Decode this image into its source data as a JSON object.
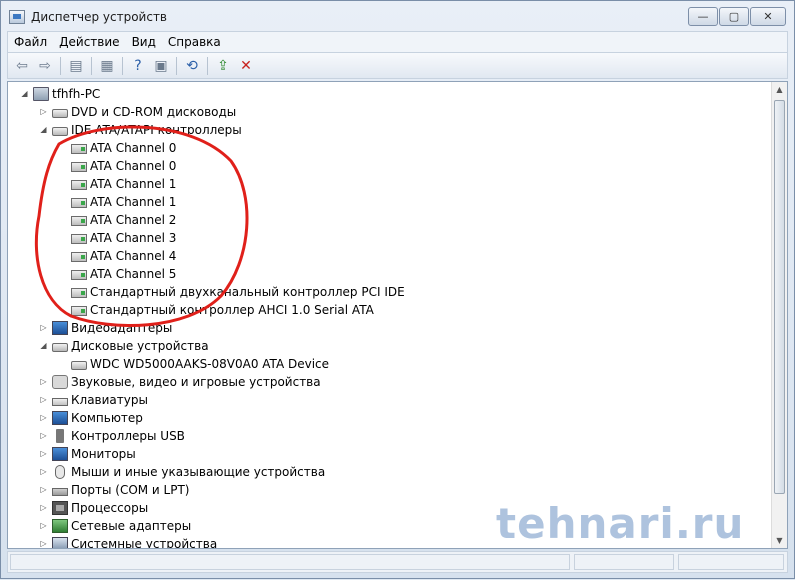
{
  "window": {
    "title": "Диспетчер устройств",
    "buttons": {
      "minimize": "—",
      "maximize": "▢",
      "close": "✕"
    }
  },
  "menu": [
    "Файл",
    "Действие",
    "Вид",
    "Справка"
  ],
  "toolbar": {
    "icons": [
      "back-arrow-icon",
      "forward-arrow-icon",
      "show-hide-console-tree-icon",
      "properties-icon",
      "help-icon",
      "view-icon",
      "scan-hardware-icon",
      "update-driver-icon",
      "uninstall-device-icon"
    ]
  },
  "tree": {
    "root": "tfhfh-PC",
    "items": [
      {
        "label": "DVD и CD-ROM дисководы",
        "icon": "dvd-drive-icon",
        "expander": "▷"
      },
      {
        "label": "IDE ATA/ATAPI контроллеры",
        "icon": "ide-controller-icon",
        "expander": "◢"
      },
      {
        "label": "ATA Channel 0",
        "icon": "ide-channel-icon"
      },
      {
        "label": "ATA Channel 0",
        "icon": "ide-channel-icon"
      },
      {
        "label": "ATA Channel 1",
        "icon": "ide-channel-icon"
      },
      {
        "label": "ATA Channel 1",
        "icon": "ide-channel-icon"
      },
      {
        "label": "ATA Channel 2",
        "icon": "ide-channel-icon"
      },
      {
        "label": "ATA Channel 3",
        "icon": "ide-channel-icon"
      },
      {
        "label": "ATA Channel 4",
        "icon": "ide-channel-icon"
      },
      {
        "label": "ATA Channel 5",
        "icon": "ide-channel-icon"
      },
      {
        "label": "Стандартный двухканальный контроллер PCI IDE",
        "icon": "ide-channel-icon"
      },
      {
        "label": "Стандартный контроллер AHCI 1.0 Serial ATA",
        "icon": "ide-channel-icon"
      },
      {
        "label": "Видеоадаптеры",
        "icon": "display-adapter-icon",
        "expander": "▷"
      },
      {
        "label": "Дисковые устройства",
        "icon": "disk-drive-icon",
        "expander": "◢"
      },
      {
        "label": "WDC WD5000AAKS-08V0A0 ATA Device",
        "icon": "disk-drive-icon"
      },
      {
        "label": "Звуковые, видео и игровые устройства",
        "icon": "sound-icon",
        "expander": "▷"
      },
      {
        "label": "Клавиатуры",
        "icon": "keyboard-icon",
        "expander": "▷"
      },
      {
        "label": "Компьютер",
        "icon": "computer-icon",
        "expander": "▷"
      },
      {
        "label": "Контроллеры USB",
        "icon": "usb-icon",
        "expander": "▷"
      },
      {
        "label": "Мониторы",
        "icon": "monitor-icon",
        "expander": "▷"
      },
      {
        "label": "Мыши и иные указывающие устройства",
        "icon": "mouse-icon",
        "expander": "▷"
      },
      {
        "label": "Порты (COM и LPT)",
        "icon": "port-icon",
        "expander": "▷"
      },
      {
        "label": "Процессоры",
        "icon": "processor-icon",
        "expander": "▷"
      },
      {
        "label": "Сетевые адаптеры",
        "icon": "network-adapter-icon",
        "expander": "▷"
      },
      {
        "label": "Системные устройства",
        "icon": "system-device-icon",
        "expander": "▷"
      }
    ]
  },
  "watermark": "tehnari.ru"
}
